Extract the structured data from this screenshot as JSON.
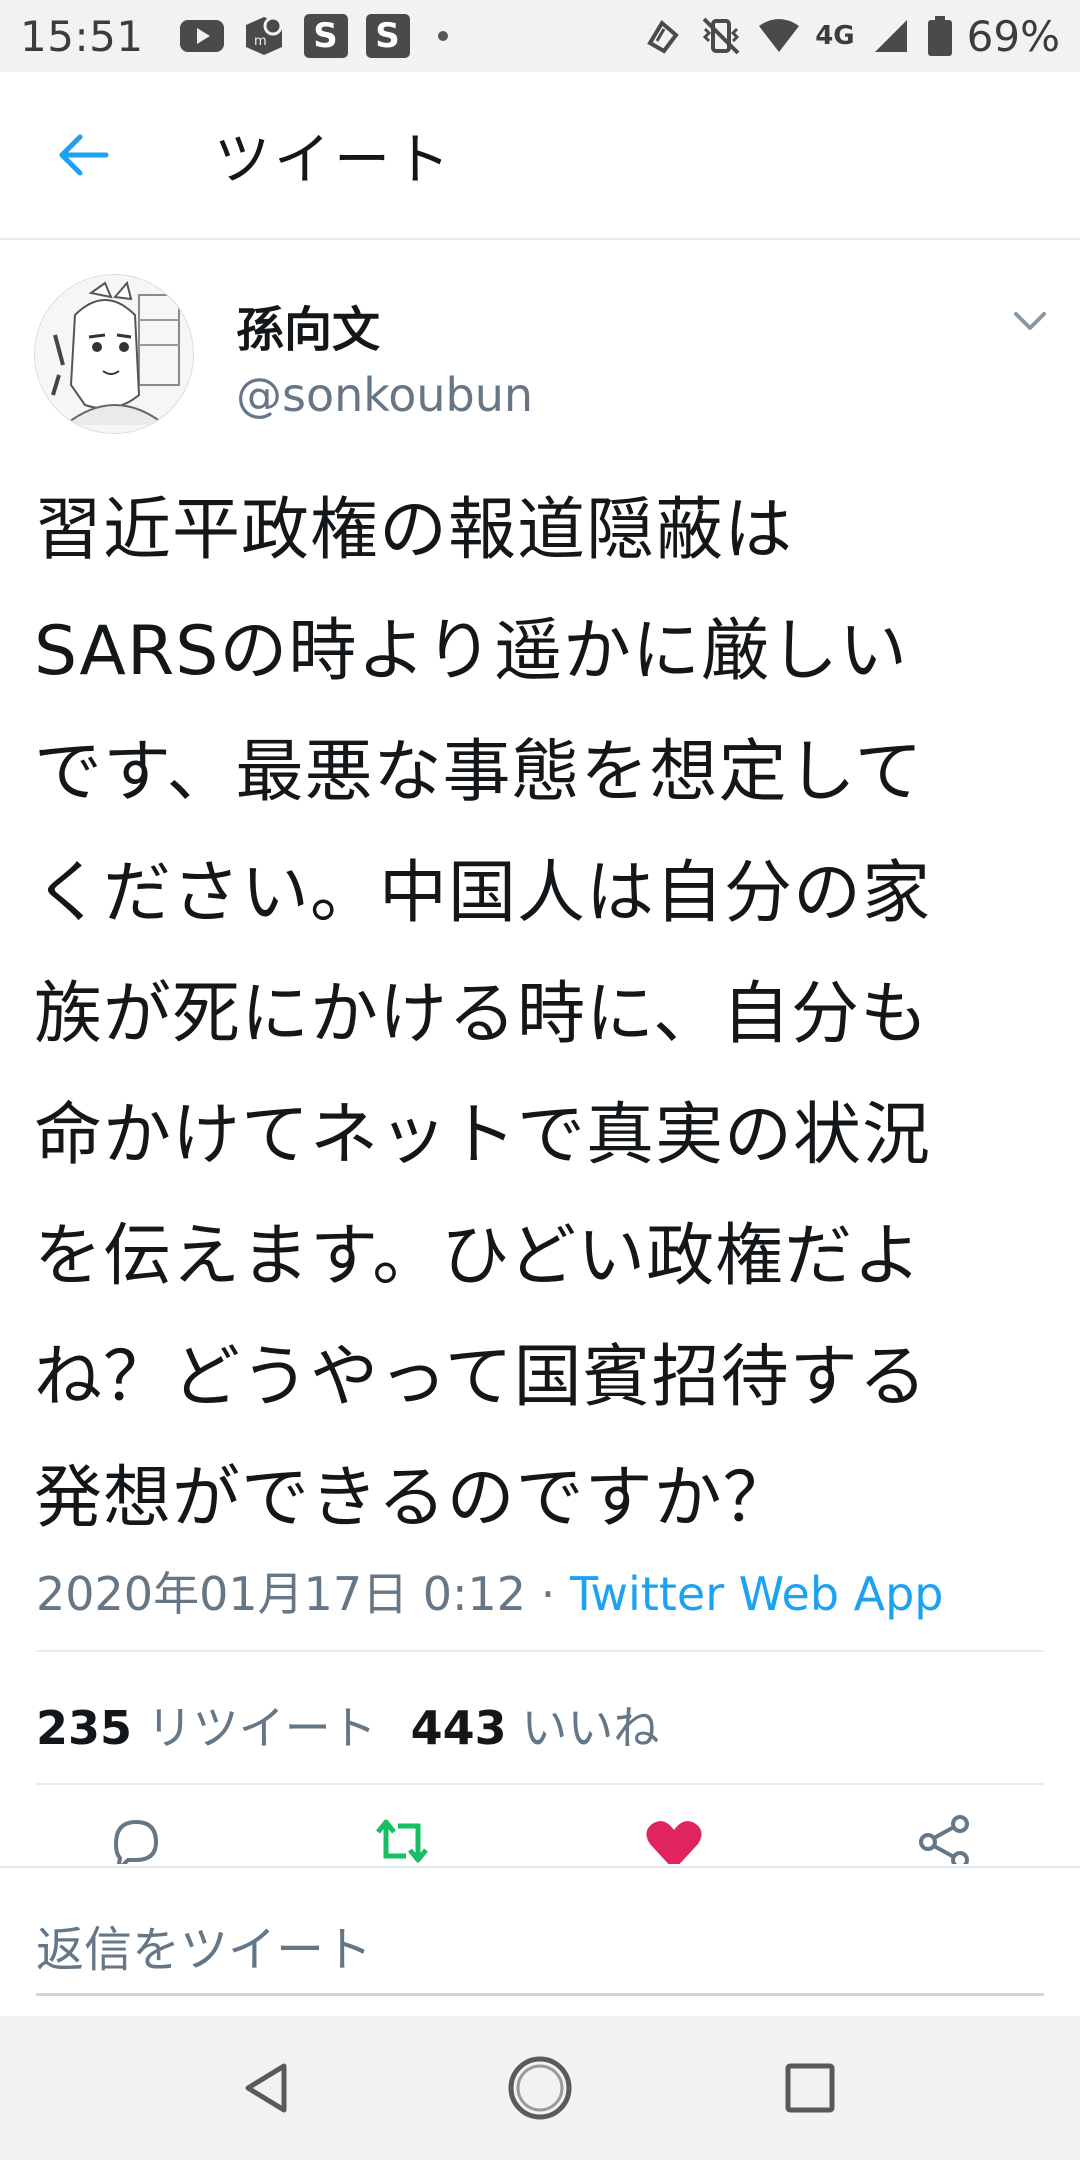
{
  "status_bar": {
    "time": "15:51",
    "battery": "69%",
    "network": "4G",
    "left_icons": [
      "youtube-icon",
      "mercari-icon",
      "s-app-icon",
      "s-app-icon",
      "notification-dot-icon"
    ],
    "right_icons": [
      "nfc-icon",
      "vibrate-icon",
      "wifi-icon",
      "signal-icon",
      "battery-icon"
    ],
    "s_label": "S"
  },
  "header": {
    "title": "ツイート",
    "back_icon": "back-arrow-icon",
    "accent": "#1da1f2"
  },
  "tweet": {
    "display_name": "孫向文",
    "handle": "@sonkoubun",
    "text_lines": [
      "習近平政権の報道隠蔽は",
      "SARSの時より遥かに厳しい",
      "です、最悪な事態を想定して",
      "ください。中国人は自分の家",
      "族が死にかける時に、自分も",
      "命かけてネットで真実の状況",
      "を伝えます。ひどい政権だよ",
      "ね？どうやって国賓招待する",
      "発想ができるのですか？"
    ],
    "timestamp": "2020年01月17日 0:12",
    "separator": " · ",
    "source": "Twitter Web App",
    "retweet_count": "235",
    "retweet_label": "リツイート",
    "like_count": "443",
    "like_label": "いいね",
    "actions": [
      {
        "name": "reply-icon",
        "color": "#657786"
      },
      {
        "name": "retweet-icon",
        "color": "#17bf63"
      },
      {
        "name": "like-icon",
        "color": "#e0245e"
      },
      {
        "name": "share-icon",
        "color": "#657786"
      }
    ]
  },
  "reply": {
    "placeholder": "返信をツイート"
  },
  "nav_bar": {
    "buttons": [
      "back-triangle-icon",
      "home-circle-icon",
      "recents-square-icon"
    ]
  }
}
